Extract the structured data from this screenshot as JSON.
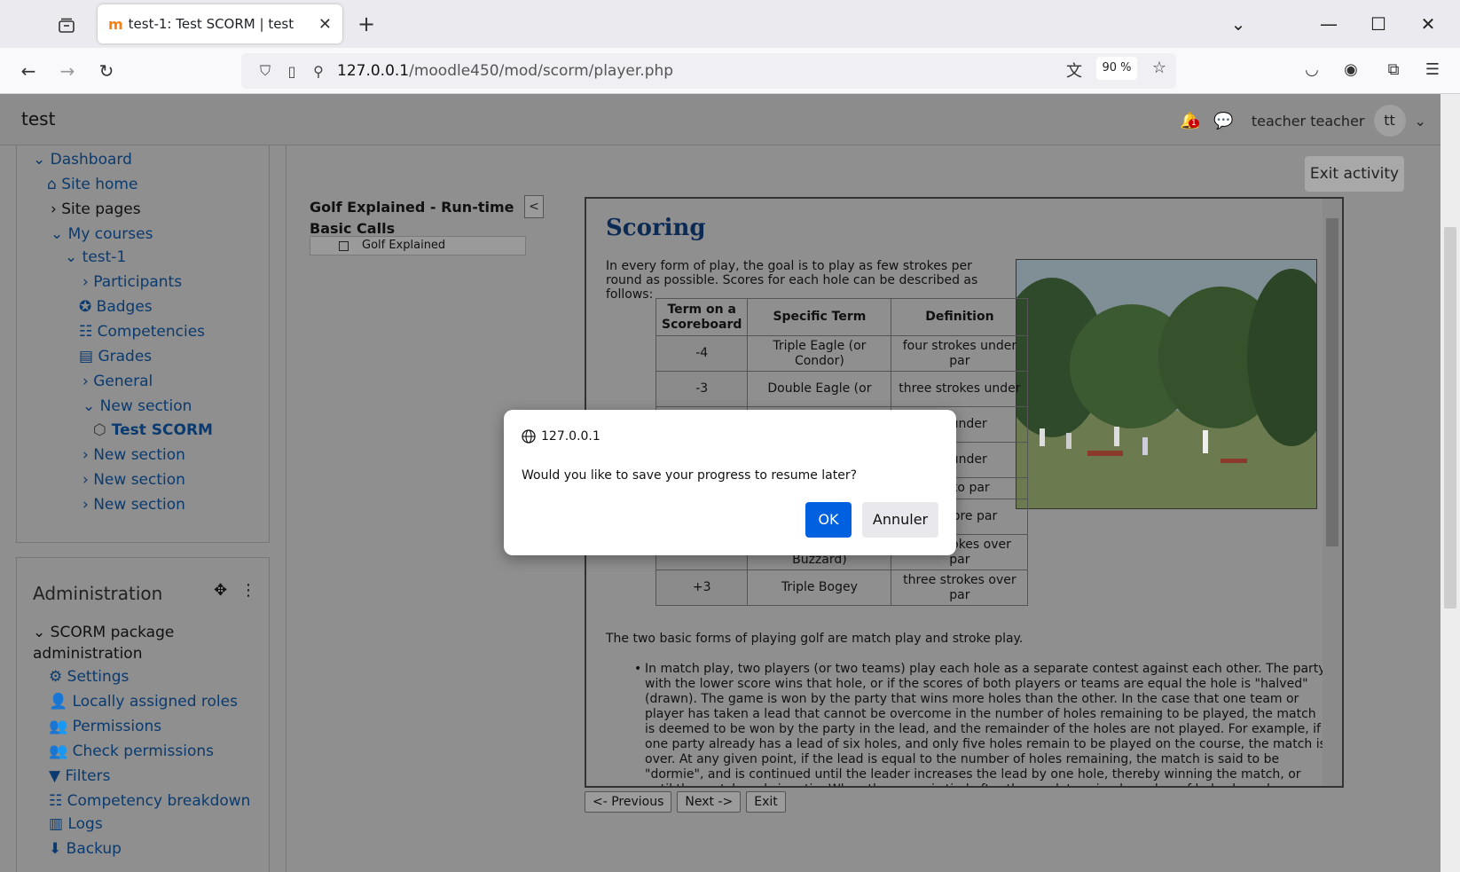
{
  "browser": {
    "tab_title": "test-1: Test SCORM | test",
    "url_host": "127.0.0.1",
    "url_path": "/moodle450/mod/scorm/player.php",
    "zoom": "90 %"
  },
  "header": {
    "site_name": "test",
    "user_name": "teacher teacher",
    "avatar_initials": "tt",
    "notification_count": "1"
  },
  "nav": {
    "dashboard": "Dashboard",
    "site_home": "Site home",
    "site_pages": "Site pages",
    "my_courses": "My courses",
    "course": "test-1",
    "participants": "Participants",
    "badges": "Badges",
    "competencies": "Competencies",
    "grades": "Grades",
    "general": "General",
    "new_section_1": "New section",
    "test_scorm": "Test SCORM",
    "new_section_2": "New section",
    "new_section_3": "New section",
    "new_section_4": "New section"
  },
  "admin": {
    "title": "Administration",
    "scorm_admin": "SCORM package administration",
    "settings": "Settings",
    "local_roles": "Locally assigned roles",
    "permissions": "Permissions",
    "check_permissions": "Check permissions",
    "filters": "Filters",
    "competency_breakdown": "Competency breakdown",
    "logs": "Logs",
    "backup": "Backup"
  },
  "player": {
    "exit_label": "Exit activity",
    "toc_title": "Golf Explained - Run-time Basic Calls",
    "toc_toggle": "<",
    "toc_item": "Golf Explained",
    "heading": "Scoring",
    "intro": "In every form of play, the goal is to play as few strokes per round as possible. Scores for each hole can be described as follows:",
    "table_headers": [
      "Term on a Scoreboard",
      "Specific Term",
      "Definition"
    ],
    "table_rows": [
      [
        "-4",
        "Triple Eagle (or Condor)",
        "four strokes under par"
      ],
      [
        "-3",
        "Double Eagle (or",
        "three strokes under"
      ],
      [
        "",
        "",
        "es under"
      ],
      [
        "",
        "",
        "ke under"
      ],
      [
        "",
        "",
        "ual to par"
      ],
      [
        "",
        "",
        "ke more par"
      ],
      [
        "+2",
        "Double Bogey (or Buzzard)",
        "two strokes over par"
      ],
      [
        "+3",
        "Triple Bogey",
        "three strokes over par"
      ]
    ],
    "forms_para": "The two basic forms of playing golf are match play and stroke play.",
    "match_play": "In match play, two players (or two teams) play each hole as a separate contest against each other. The party with the lower score wins that hole, or if the scores of both players or teams are equal the hole is \"halved\" (drawn). The game is won by the party that wins more holes than the other. In the case that one team or player has taken a lead that cannot be overcome in the number of holes remaining to be played, the match is deemed to be won by the party in the lead, and the remainder of the holes are not played. For example, if one party already has a lead of six holes, and only five holes remain to be played on the course, the match is over. At any given point, if the lead is equal to the number of holes remaining, the match is said to be \"dormie\", and is continued until the leader increases the lead by one hole, thereby winning the match, or until the match ends in a tie. When the game is tied after the predetermined number of holes have been played, it may be continued until one side takes a one-hole lead.",
    "btn_prev": "<- Previous",
    "btn_next": "Next ->",
    "btn_exit": "Exit"
  },
  "dialog": {
    "origin": "127.0.0.1",
    "message": "Would you like to save your progress to resume later?",
    "ok": "OK",
    "cancel": "Annuler"
  }
}
